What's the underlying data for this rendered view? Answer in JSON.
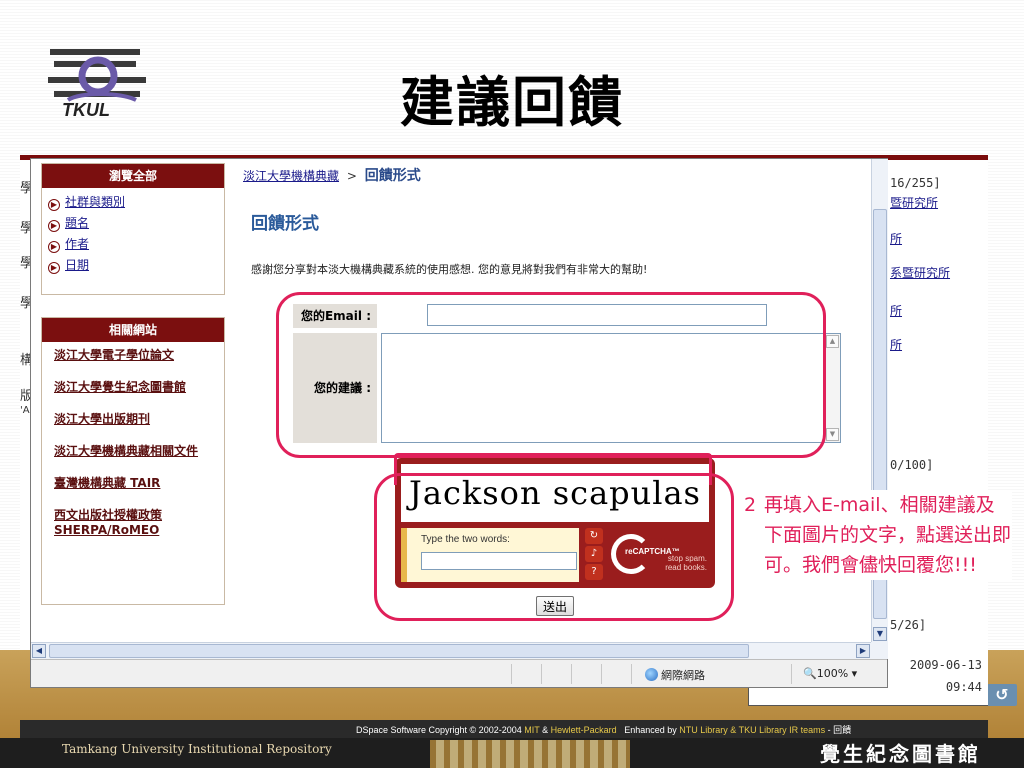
{
  "slide": {
    "title": "建議回饋",
    "logo_text": "TKUL"
  },
  "background_page": {
    "left_letters": [
      "學",
      "學",
      "學",
      "學",
      "構",
      "版"
    ],
    "left_extra": "'A",
    "right_col": [
      "16/255]",
      "暨研究所",
      "所",
      "系暨研究所",
      "所",
      "所",
      "0/100]",
      "5/26]"
    ]
  },
  "sidebar": {
    "browse_head": "瀏覽全部",
    "browse_items": [
      "社群與類別",
      "題名",
      "作者",
      "日期"
    ],
    "related_head": "相關網站",
    "related_items": [
      "淡江大學電子學位論文",
      "淡江大學覺生紀念圖書館",
      "淡江大學出版期刊",
      "淡江大學機構典藏相關文件",
      "臺灣機構典藏 TAIR",
      "西文出版社授權政策 SHERPA/RoMEO"
    ]
  },
  "main": {
    "breadcrumb_home": "淡江大學機構典藏",
    "breadcrumb_sep": ">",
    "breadcrumb_current": "回饋形式",
    "page_heading": "回饋形式",
    "intro": "感謝您分享對本淡大機構典藏系統的使用感想. 您的意見將對我們有非常大的幫助!",
    "email_label": "您的Email :",
    "suggestion_label": "您的建議 :",
    "submit_label": "送出"
  },
  "captcha": {
    "words": "Jackson scapulas",
    "prompt": "Type the two words:",
    "brand": "reCAPTCHA™",
    "tagline_1": "stop spam.",
    "tagline_2": "read books."
  },
  "browser_status": {
    "zone": "網際網路",
    "zoom": "100%"
  },
  "callout": {
    "number": "2",
    "text": "再填入E-mail、相關建議及下面圖片的文字，點選送出即可。我們會儘快回覆您!!!"
  },
  "datebox": {
    "date": "2009-06-13",
    "time": "09:44"
  },
  "footer": {
    "copyright_prefix": "DSpace Software Copyright © 2002-2004",
    "copyright_mit": "MIT",
    "copyright_and": "&",
    "copyright_hp": "Hewlett-Packard",
    "enhanced_by": "Enhanced by",
    "enhanced_teams": "NTU Library & TKU Library IR teams",
    "enhanced_tail": "- 回饋",
    "repository_name": "Tamkang University Institutional Repository",
    "library_name": "覺生紀念圖書館"
  },
  "colors": {
    "accent": "#7b0f0f",
    "annotation": "#e0205a",
    "footer_gold": "#c9a25a"
  }
}
